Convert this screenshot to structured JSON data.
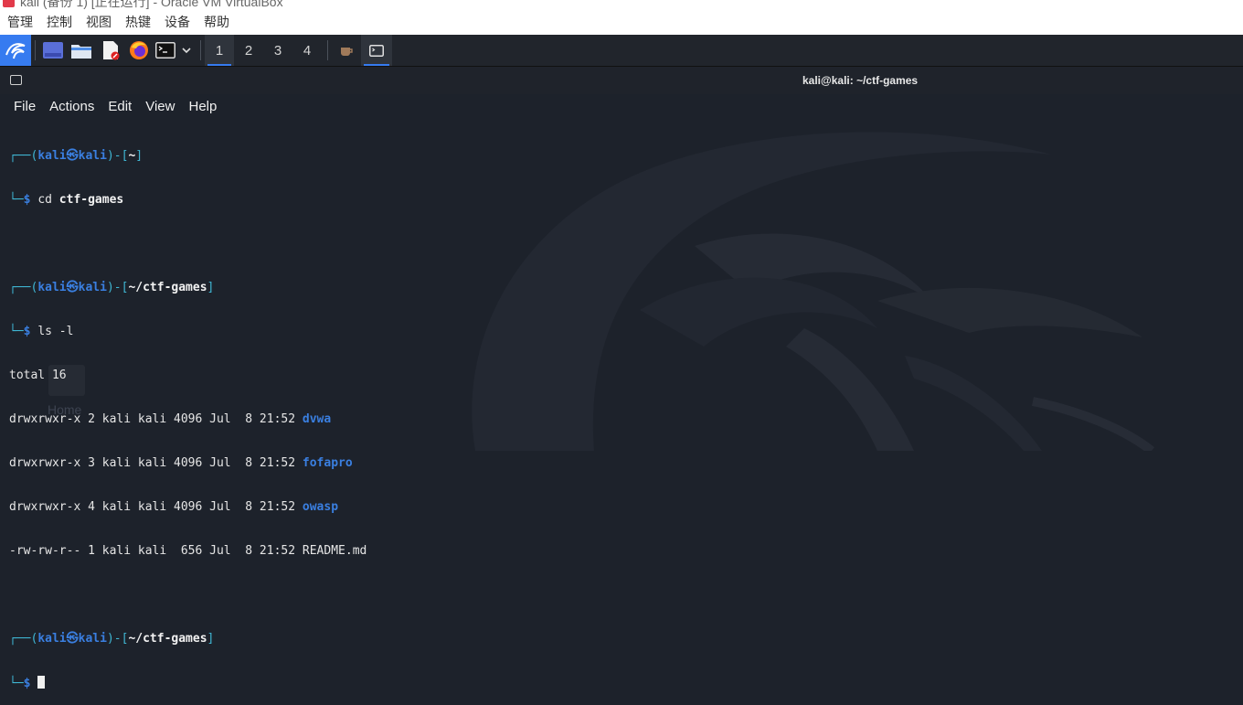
{
  "vbox": {
    "window_title": "kali (备份 1) [正在运行] - Oracle VM VirtualBox",
    "menu": [
      "管理",
      "控制",
      "视图",
      "热键",
      "设备",
      "帮助"
    ]
  },
  "panel": {
    "workspaces": [
      "1",
      "2",
      "3",
      "4"
    ]
  },
  "terminal": {
    "title": "kali@kali: ~/ctf-games",
    "menu": [
      "File",
      "Actions",
      "Edit",
      "View",
      "Help"
    ],
    "prompts": [
      {
        "user": "kali",
        "host": "kali",
        "path": "~",
        "cmd_prefix": "cd ",
        "cmd": "ctf-games"
      },
      {
        "user": "kali",
        "host": "kali",
        "path": "~/ctf-games",
        "cmd_prefix": "",
        "cmd": "ls -l"
      },
      {
        "user": "kali",
        "host": "kali",
        "path": "~/ctf-games",
        "cmd_prefix": "",
        "cmd": ""
      }
    ],
    "ls_total": "total 16",
    "ls_rows": [
      {
        "meta": "drwxrwxr-x 2 kali kali 4096 Jul  8 21:52 ",
        "name": "dvwa",
        "is_dir": true
      },
      {
        "meta": "drwxrwxr-x 3 kali kali 4096 Jul  8 21:52 ",
        "name": "fofapro",
        "is_dir": true
      },
      {
        "meta": "drwxrwxr-x 4 kali kali 4096 Jul  8 21:52 ",
        "name": "owasp",
        "is_dir": true
      },
      {
        "meta": "-rw-rw-r-- 1 kali kali  656 Jul  8 21:52 ",
        "name": "README.md",
        "is_dir": false
      }
    ]
  },
  "desktop": {
    "home_label": "Home"
  },
  "colors": {
    "accent": "#367bf0",
    "prompt": "#3fb6d3",
    "dir": "#3a7fe0",
    "background": "#1d222b"
  }
}
